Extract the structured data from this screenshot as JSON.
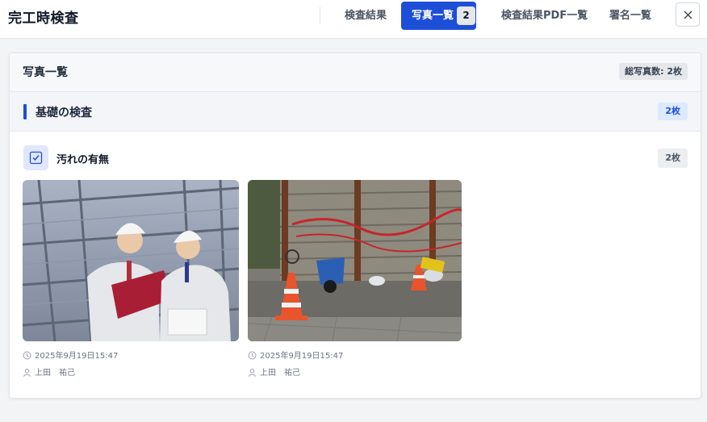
{
  "header": {
    "title": "完工時検査",
    "tabs": [
      {
        "label": "検査結果"
      },
      {
        "label": "写真一覧",
        "badge": "2",
        "active": true
      },
      {
        "label": "検査結果PDF一覧"
      },
      {
        "label": "署名一覧"
      }
    ]
  },
  "panel": {
    "title": "写真一覧",
    "total": "総写真数: 2枚"
  },
  "section": {
    "title": "基礎の検査",
    "count": "2枚",
    "items": [
      {
        "title": "汚れの有無",
        "count": "2枚",
        "photos": [
          {
            "subject": "two-workers-with-folder-and-tablet",
            "date": "2025年9月19日15:47",
            "user": "上田　祐己"
          },
          {
            "subject": "construction-site-wall-with-cones",
            "date": "2025年9月19日15:47",
            "user": "上田　祐己"
          }
        ]
      }
    ]
  },
  "colors": {
    "accent": "#1d4ed8",
    "badge_bg": "#dbeafe"
  }
}
